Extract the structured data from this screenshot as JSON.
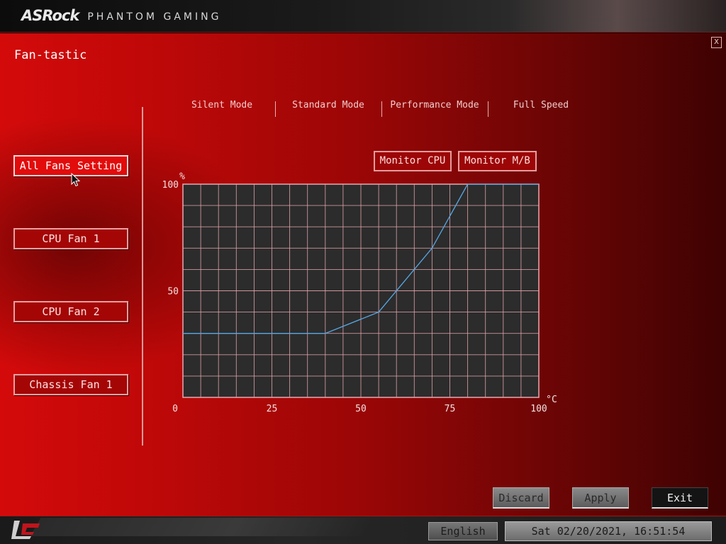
{
  "header": {
    "brand": "ASRock",
    "sub_brand": "PHANTOM GAMING"
  },
  "page": {
    "title": "Fan-tastic",
    "close_label": "X"
  },
  "fans": [
    {
      "label": "All Fans Setting",
      "active": true
    },
    {
      "label": "CPU Fan 1",
      "active": false
    },
    {
      "label": "CPU Fan 2",
      "active": false
    },
    {
      "label": "Chassis Fan 1",
      "active": false
    }
  ],
  "modes": [
    "Silent Mode",
    "Standard Mode",
    "Performance Mode",
    "Full Speed"
  ],
  "monitor": {
    "cpu_label": "Monitor CPU",
    "mb_label": "Monitor M/B"
  },
  "chart_data": {
    "type": "line",
    "ylabel": "%",
    "xlabel": "°C",
    "xlim": [
      0,
      100
    ],
    "ylim": [
      0,
      100
    ],
    "x_ticks": [
      "0",
      "25",
      "50",
      "75",
      "100"
    ],
    "y_ticks": [
      "100",
      "50"
    ],
    "x_tick_values": [
      0,
      25,
      50,
      75,
      100
    ],
    "y_tick_values": [
      100,
      50
    ],
    "grid": true,
    "series": [
      {
        "x": [
          0,
          40,
          55,
          70,
          80,
          100
        ],
        "y": [
          30,
          30,
          40,
          70,
          100,
          100
        ]
      }
    ],
    "colors": {
      "line": "#56a8e6",
      "grid": "#e8a8b0",
      "plot_bg": "#2c2c2c"
    }
  },
  "actions": {
    "discard": "Discard",
    "apply": "Apply",
    "exit": "Exit"
  },
  "footer": {
    "language": "English",
    "datetime": "Sat 02/20/2021, 16:51:54"
  }
}
